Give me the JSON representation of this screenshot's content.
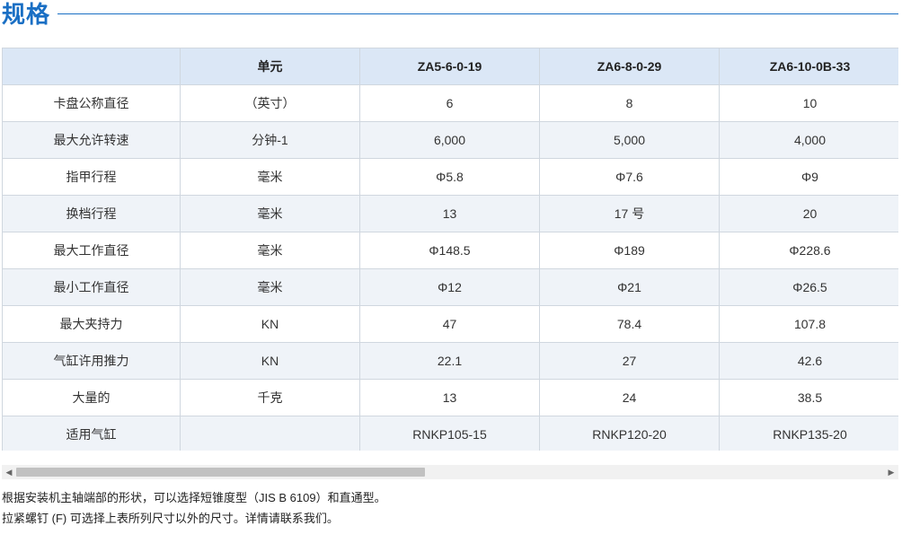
{
  "section": {
    "title": "规格"
  },
  "table": {
    "headers": [
      "",
      "单元",
      "ZA5-6-0-19",
      "ZA6-8-0-29",
      "ZA6-10-0B-33"
    ],
    "rows": [
      [
        "卡盘公称直径",
        "（英寸）",
        "6",
        "8",
        "10"
      ],
      [
        "最大允许转速",
        "分钟-1",
        "6,000",
        "5,000",
        "4,000"
      ],
      [
        "指甲行程",
        "毫米",
        "Φ5.8",
        "Φ7.6",
        "Φ9"
      ],
      [
        "换档行程",
        "毫米",
        "13",
        "17 号",
        "20"
      ],
      [
        "最大工作直径",
        "毫米",
        "Φ148.5",
        "Φ189",
        "Φ228.6"
      ],
      [
        "最小工作直径",
        "毫米",
        "Φ12",
        "Φ21",
        "Φ26.5"
      ],
      [
        "最大夹持力",
        "KN",
        "47",
        "78.4",
        "107.8"
      ],
      [
        "气缸许用推力",
        "KN",
        "22.1",
        "27",
        "42.6"
      ],
      [
        "大量的",
        "千克",
        "13",
        "24",
        "38.5"
      ],
      [
        "适用气缸",
        "",
        "RNKP105-15",
        "RNKP120-20",
        "RNKP135-20"
      ]
    ]
  },
  "scrollbar": {
    "left_arrow": "◀",
    "right_arrow": "▶",
    "icon_left": "arrow-left-icon",
    "icon_right": "arrow-right-icon"
  },
  "notes": [
    "根据安装机主轴端部的形状，可以选择短锥度型（JIS B 6109）和直通型。",
    "拉紧螺钉 (F) 可选择上表所列尺寸以外的尺寸。详情请联系我们。"
  ],
  "colors": {
    "title": "#1a6fc4",
    "header_bg": "#dbe7f6",
    "stripe_bg": "#eff3f8",
    "border": "#d0d7df"
  }
}
